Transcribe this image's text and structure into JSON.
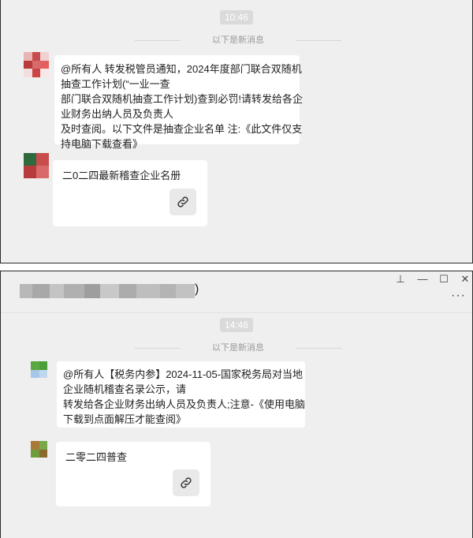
{
  "panel1": {
    "time": "10:46",
    "new_messages_label": "以下是新消息",
    "message1": {
      "lines": [
        "@所有人 转发税管员通知，2024年度部门联合双随机",
        "抽查工作计划(“一业一查",
        "部门联合双随机抽查工作计划)查到必罚!请转发给各企",
        "业财务出纳人员及负责人",
        "及时查阅。以下文件是抽查企业名单 注:《此文件仅支",
        "持电脑下载查看》"
      ]
    },
    "message2": {
      "title": "二0二四最新稽查企业名册"
    }
  },
  "panel2": {
    "window": {
      "title_suffix": ")",
      "pin_icon": "⊥",
      "minimize_icon": "—",
      "maximize_icon": "☐",
      "close_icon": "✕",
      "more_icon": "···"
    },
    "time": "14:46",
    "new_messages_label": "以下是新消息",
    "message1": {
      "lines": [
        "@所有人【税务内参】2024-11-05-国家税务局对当地",
        "企业随机稽查名录公示，请",
        "转发给各企业财务出纳人员及负责人;注意-《使用电脑",
        "下载到点面解压才能查阅》"
      ]
    },
    "message2": {
      "title": "二零二四普查"
    }
  },
  "colors": {
    "chat_bg": "#efefef",
    "bubble_bg": "#ffffff",
    "time_pill": "#dadada",
    "divider_text": "#9a9a9a"
  }
}
